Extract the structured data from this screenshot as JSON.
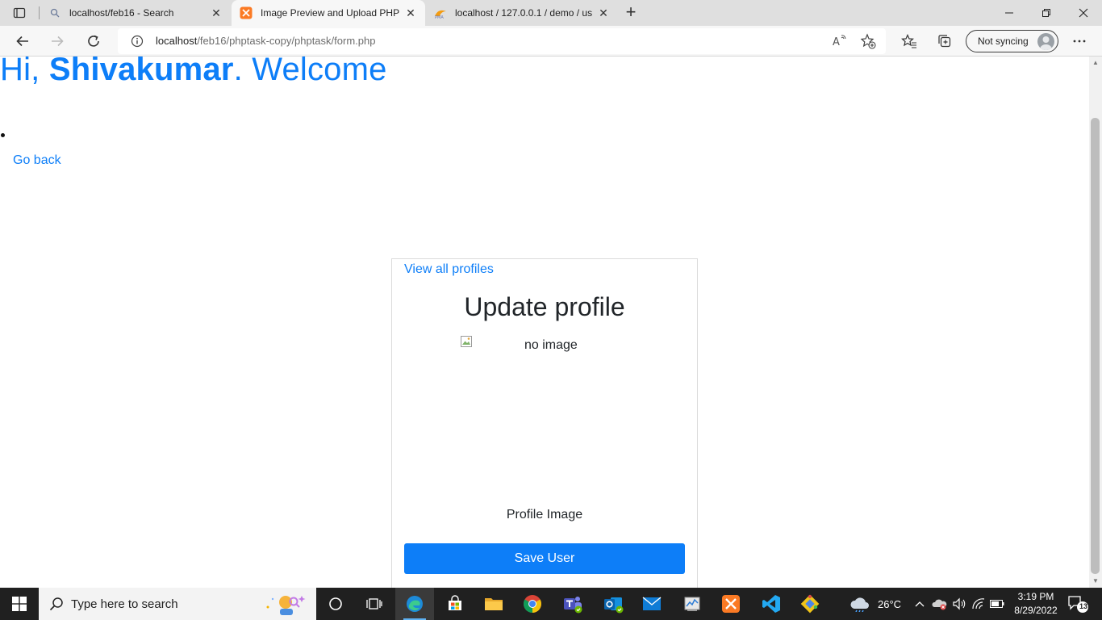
{
  "browser": {
    "tabs": [
      {
        "title": "localhost/feb16 - Search",
        "icon": "search-icon",
        "active": false
      },
      {
        "title": "Image Preview and Upload PHP",
        "icon": "xampp-icon",
        "active": true
      },
      {
        "title": "localhost / 127.0.0.1 / demo / us",
        "icon": "phpmyadmin-icon",
        "active": false
      }
    ],
    "address": {
      "host": "localhost",
      "path": "/feb16/phptask-copy/phptask/form.php"
    },
    "sync_label": "Not syncing"
  },
  "page": {
    "greeting_prefix": "Hi, ",
    "username": "Shivakumar",
    "greeting_suffix": ". Welcome",
    "go_back": "Go back",
    "card": {
      "view_all": "View all profiles",
      "title": "Update profile",
      "image_alt": "no image",
      "image_label": "Profile Image",
      "save_button": "Save User"
    }
  },
  "taskbar": {
    "search_placeholder": "Type here to search",
    "weather": "26°C",
    "time": "3:19 PM",
    "date": "8/29/2022",
    "notifications": "13"
  },
  "colors": {
    "accent": "#0d7ef8",
    "taskbar": "#202020"
  }
}
